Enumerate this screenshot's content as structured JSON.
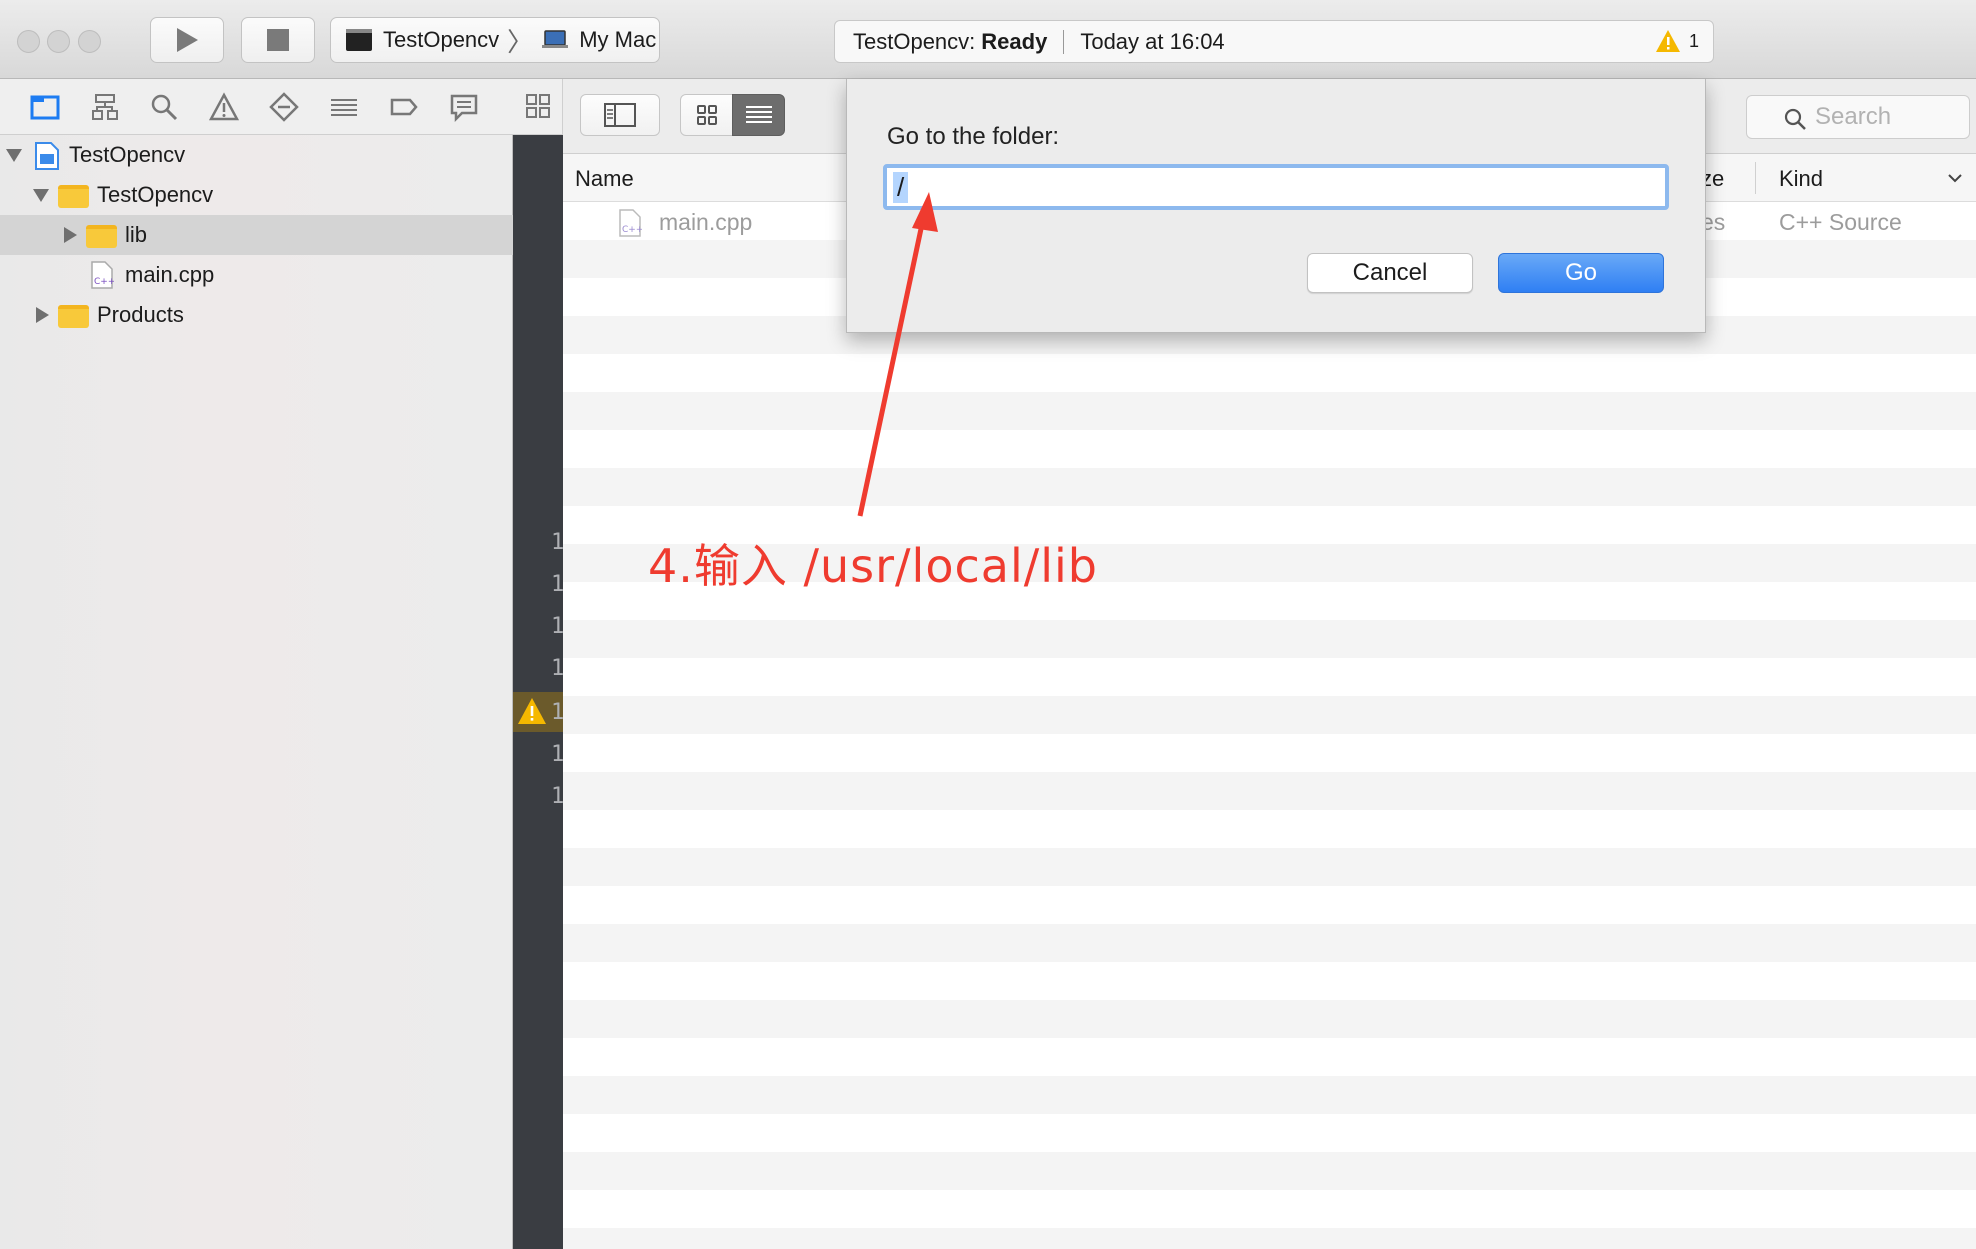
{
  "toolbar": {
    "scheme_target": "TestOpencv",
    "scheme_device": "My Mac",
    "status_project": "TestOpencv:",
    "status_state": "Ready",
    "status_time": "Today at 16:04",
    "warning_count": "1"
  },
  "navigator": {
    "items": [
      {
        "label": "TestOpencv",
        "level": 0,
        "kind": "project",
        "expanded": true
      },
      {
        "label": "TestOpencv",
        "level": 1,
        "kind": "folder",
        "expanded": true
      },
      {
        "label": "lib",
        "level": 2,
        "kind": "folder",
        "expanded": false,
        "selected": true
      },
      {
        "label": "main.cpp",
        "level": 2,
        "kind": "cpp-file"
      },
      {
        "label": "Products",
        "level": 1,
        "kind": "folder",
        "expanded": false
      }
    ]
  },
  "gutter": {
    "line_numbers": [
      "1",
      "1",
      "1",
      "1",
      "1",
      "1",
      "1"
    ]
  },
  "browser": {
    "search_placeholder": "Search",
    "columns": {
      "name": "Name",
      "size": "ze",
      "kind": "Kind"
    },
    "rows": [
      {
        "name": "main.cpp",
        "size": "es",
        "kind": "C++ Source"
      }
    ]
  },
  "dialog": {
    "title": "Go to the folder:",
    "input_value": "/",
    "cancel_label": "Cancel",
    "go_label": "Go"
  },
  "annotation": {
    "text": "4.输入 /usr/local/lib",
    "color": "#ef3b2f"
  },
  "colors": {
    "accent": "#2f7ff3",
    "focus_ring": "#8db9ee",
    "folder": "#f8c93a",
    "warning": "#f5b800"
  }
}
